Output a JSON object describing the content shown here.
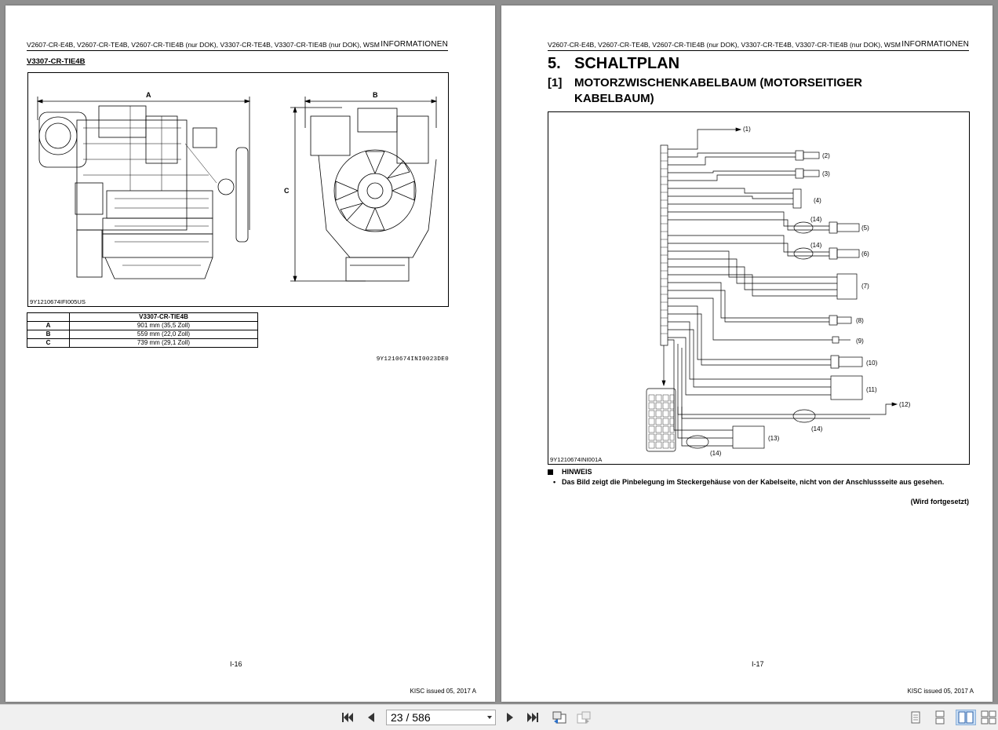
{
  "viewer": {
    "current_page": "23",
    "page_separator": "/",
    "total_pages": "586",
    "buttons": [
      "first-page",
      "previous-page",
      "next-page",
      "last-page",
      "go-back-view",
      "go-forward-view",
      "single-page-view",
      "continuous-view",
      "facing-view",
      "continuous-facing-view"
    ]
  },
  "left_page": {
    "header_models": "V2607-CR-E4B, V2607-CR-TE4B, V2607-CR-TIE4B (nur DOK), V3307-CR-TE4B, V3307-CR-TIE4B (nur DOK), WSM",
    "header_chapter": "INFORMATIONEN",
    "section_subtitle": "V3307-CR-TIE4B",
    "figure": {
      "label_a": "A",
      "label_b": "B",
      "label_c": "C",
      "code": "9Y1210674IFI005US"
    },
    "table": {
      "header": "V3307-CR-TIE4B",
      "rows": [
        {
          "key": "A",
          "value": "901 mm (35,5 Zoll)"
        },
        {
          "key": "B",
          "value": "559 mm (22,0 Zoll)"
        },
        {
          "key": "C",
          "value": "739 mm (29,1 Zoll)"
        }
      ]
    },
    "ref_code": "9Y1210674INI0023DE0",
    "page_number": "I-16",
    "issued": "KISC issued 05, 2017 A"
  },
  "right_page": {
    "header_models": "V2607-CR-E4B, V2607-CR-TE4B, V2607-CR-TIE4B (nur DOK), V3307-CR-TE4B, V3307-CR-TIE4B (nur DOK), WSM",
    "header_chapter": "INFORMATIONEN",
    "chapter_number": "5.",
    "chapter_title": "SCHALTPLAN",
    "section_number": "[1]",
    "section_title": "MOTORZWISCHENKABELBAUM (MOTORSEITIGER KABELBAUM)",
    "diagram": {
      "callouts": [
        "(1)",
        "(2)",
        "(3)",
        "(4)",
        "(5)",
        "(6)",
        "(7)",
        "(8)",
        "(9)",
        "(10)",
        "(11)",
        "(12)",
        "(13)",
        "(14)"
      ],
      "code": "9Y1210674INI001A"
    },
    "note_heading": "HINWEIS",
    "note_text": "Das Bild zeigt die Pinbelegung im Steckergehäuse von der Kabelseite, nicht von der Anschlussseite aus gesehen.",
    "continued": "(Wird fortgesetzt)",
    "page_number": "I-17",
    "issued": "KISC issued 05, 2017 A"
  }
}
